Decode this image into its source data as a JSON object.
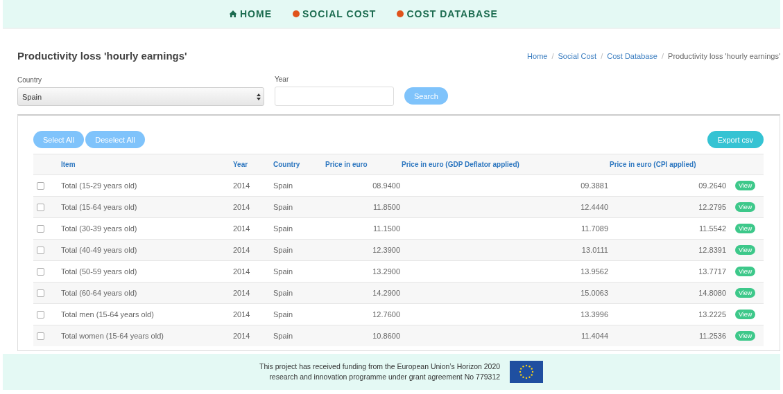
{
  "nav": [
    {
      "label": "HOME",
      "kind": "home"
    },
    {
      "label": "SOCIAL COST",
      "kind": "dot"
    },
    {
      "label": "COST DATABASE",
      "kind": "dot"
    }
  ],
  "title": "Productivity loss 'hourly earnings'",
  "breadcrumb": {
    "links": [
      {
        "label": "Home",
        "separator": "/"
      },
      {
        "label": "Social Cost",
        "separator": "/"
      },
      {
        "label": "Cost Database",
        "separator": "/"
      }
    ],
    "current": "Productivity loss 'hourly earnings'"
  },
  "filters": {
    "country": {
      "label": "Country",
      "value": "Spain"
    },
    "year": {
      "label": "Year"
    },
    "search_button": "Search"
  },
  "actions": {
    "select_all": "Select All",
    "deselect_all": "Deselect All",
    "export": "Export csv"
  },
  "table": {
    "columns": [
      "Item",
      "Year",
      "Country",
      "Price in euro",
      "Price in euro (GDP Deflator applied)",
      "Price in euro (CPI applied)"
    ],
    "rows": [
      {
        "checked": false,
        "item": "Total (15-29 years old)",
        "year": "2014",
        "country": "Spain",
        "price": "08.9400",
        "gdp": "09.3881",
        "cpi": "09.2640",
        "action": "View"
      },
      {
        "checked": false,
        "item": "Total (15-64 years old)",
        "year": "2014",
        "country": "Spain",
        "price": "11.8500",
        "gdp": "12.4440",
        "cpi": "12.2795",
        "action": "View"
      },
      {
        "checked": false,
        "item": "Total (30-39 years old)",
        "year": "2014",
        "country": "Spain",
        "price": "11.1500",
        "gdp": "11.7089",
        "cpi": "11.5542",
        "action": "View"
      },
      {
        "checked": false,
        "item": "Total (40-49 years old)",
        "year": "2014",
        "country": "Spain",
        "price": "12.3900",
        "gdp": "13.0111",
        "cpi": "12.8391",
        "action": "View"
      },
      {
        "checked": false,
        "item": "Total (50-59 years old)",
        "year": "2014",
        "country": "Spain",
        "price": "13.2900",
        "gdp": "13.9562",
        "cpi": "13.7717",
        "action": "View"
      },
      {
        "checked": false,
        "item": "Total (60-64 years old)",
        "year": "2014",
        "country": "Spain",
        "price": "14.2900",
        "gdp": "15.0063",
        "cpi": "14.8080",
        "action": "View"
      },
      {
        "checked": false,
        "item": "Total men (15-64 years old)",
        "year": "2014",
        "country": "Spain",
        "price": "12.7600",
        "gdp": "13.3996",
        "cpi": "13.2225",
        "action": "View"
      },
      {
        "checked": false,
        "item": "Total women (15-64 years old)",
        "year": "2014",
        "country": "Spain",
        "price": "10.8600",
        "gdp": "11.4044",
        "cpi": "11.2536",
        "action": "View"
      }
    ]
  },
  "footer": {
    "lines": [
      "This project has received funding from the European Union’s Horizon 2020",
      "research and innovation programme under grant agreement No 779312"
    ]
  }
}
